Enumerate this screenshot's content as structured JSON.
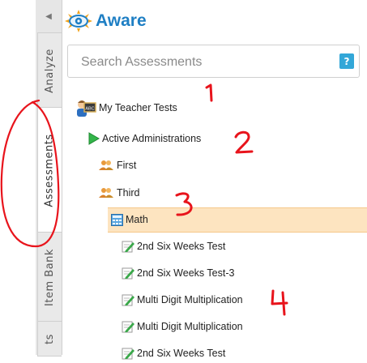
{
  "app": {
    "logo_text": "Aware"
  },
  "side_tabs": [
    {
      "label": "Analyze"
    },
    {
      "label": "Assessments"
    },
    {
      "label": "Item Bank"
    },
    {
      "label": "ts"
    }
  ],
  "search": {
    "placeholder": "Search Assessments",
    "value": "",
    "help_label": "?"
  },
  "tree": {
    "root": "My Teacher Tests",
    "active": "Active Administrations",
    "groups": [
      "First",
      "Third"
    ],
    "subject": "Math",
    "tests": [
      "2nd Six Weeks Test",
      "2nd Six Weeks Test-3",
      "Multi Digit Multiplication",
      "Multi Digit Multiplication",
      "2nd Six Weeks Test"
    ]
  },
  "annotations": [
    "1",
    "2",
    "3",
    "4"
  ],
  "colors": {
    "brand": "#1f7fc4",
    "selection": "#fde4c0",
    "annotation": "#e8141c"
  }
}
